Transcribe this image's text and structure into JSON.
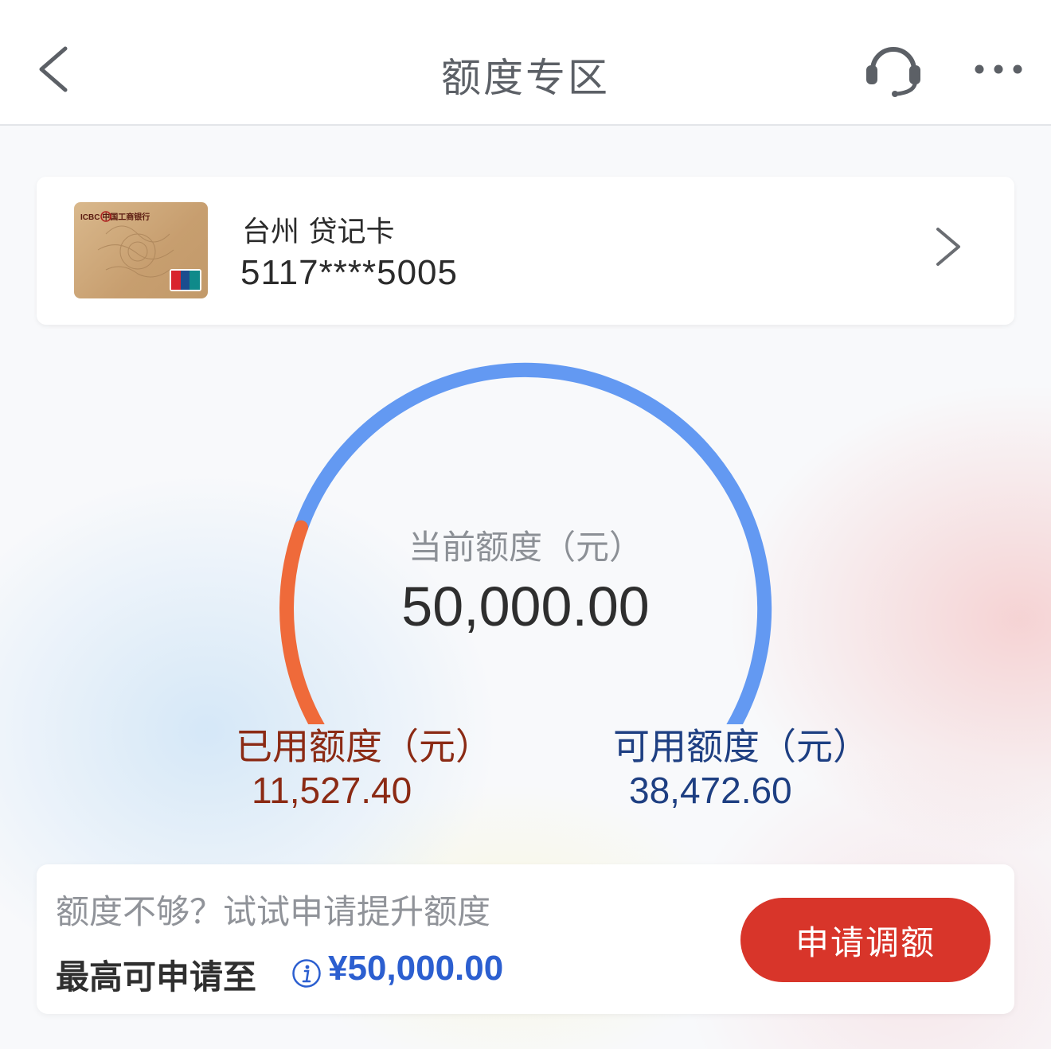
{
  "header": {
    "title": "额度专区",
    "back_icon": "chevron-left-icon",
    "support_icon": "headset-icon",
    "more_icon": "more-dots-icon"
  },
  "card": {
    "name": "台州 贷记卡",
    "number": "5117****5005",
    "logo_text": "ICBC 中国工商银行",
    "network_text": "UnionPay 银联"
  },
  "gauge": {
    "label": "当前额度（元）",
    "total_value": "50,000.00",
    "used_label": "已用额度（元）",
    "used_value": "11,527.40",
    "available_label": "可用额度（元）",
    "available_value": "38,472.60",
    "used_fraction": 0.2305,
    "used_color": "#ef6a3a",
    "available_color": "#6399f2"
  },
  "promo": {
    "hint": "额度不够？试试申请提升额度",
    "max_label": "最高可申请至",
    "max_value": "¥50,000.00",
    "button_label": "申请调额",
    "button_color": "#d8352a"
  }
}
